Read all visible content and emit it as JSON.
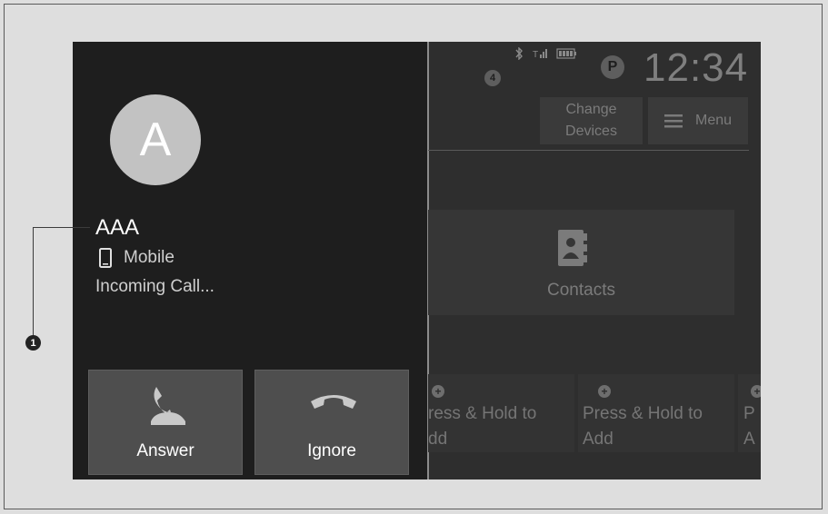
{
  "call": {
    "avatar_letter": "A",
    "caller_name": "AAA",
    "caller_type": "Mobile",
    "status": "Incoming Call...",
    "answer_label": "Answer",
    "ignore_label": "Ignore"
  },
  "status_bar": {
    "clock": "12:34",
    "park_badge": "P",
    "notification_count": "4",
    "icons": [
      "bluetooth-icon",
      "signal-icon",
      "battery-icon"
    ]
  },
  "home": {
    "change_devices_label_1": "Change",
    "change_devices_label_2": "Devices",
    "menu_label": "Menu",
    "contacts_label": "Contacts",
    "tile1_line1": "ress & Hold to",
    "tile1_line2": "dd",
    "tile2_line1": "Press & Hold to",
    "tile2_line2": "Add",
    "tile3_line1": "P",
    "tile3_line2": "A"
  },
  "callout": {
    "number": "1"
  },
  "colors": {
    "screen_bg": "#1e1e1e",
    "button_bg": "#4e4e4e",
    "avatar_bg": "#c2c2c2"
  }
}
